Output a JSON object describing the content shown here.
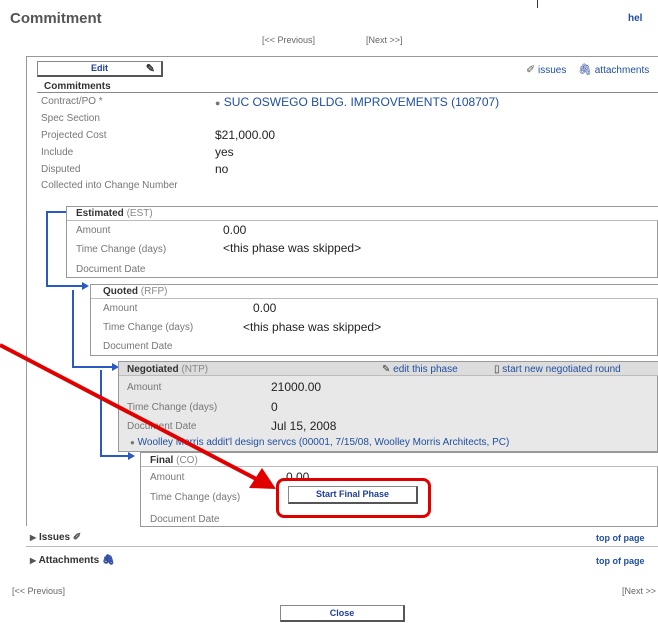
{
  "window": {
    "title": "Commitment",
    "help": "hel"
  },
  "nav": {
    "prev": "[<< Previous]",
    "next": "[Next >>]",
    "next_bottom": "[Next >>"
  },
  "toolbar": {
    "edit_label": "Edit",
    "issues_label": "issues",
    "attachments_label": "attachments"
  },
  "commitments": {
    "heading": "Commitments",
    "rows": [
      {
        "label": "Contract/PO *",
        "value": "SUC OSWEGO BLDG. IMPROVEMENTS (108707)"
      },
      {
        "label": "Spec Section",
        "value": ""
      },
      {
        "label": "Projected Cost",
        "value": "$21,000.00"
      },
      {
        "label": "Include",
        "value": "yes"
      },
      {
        "label": "Disputed",
        "value": "no"
      },
      {
        "label": "Collected into Change Number",
        "value": ""
      }
    ]
  },
  "phases": {
    "estimated": {
      "name": "Estimated",
      "code": "(EST)",
      "amount_label": "Amount",
      "amount": "0.00",
      "time_label": "Time Change (days)",
      "time": "<this phase was skipped>",
      "date_label": "Document Date"
    },
    "quoted": {
      "name": "Quoted",
      "code": "(RFP)",
      "amount_label": "Amount",
      "amount": "0.00",
      "time_label": "Time Change (days)",
      "time": "<this phase was skipped>",
      "date_label": "Document Date"
    },
    "negotiated": {
      "name": "Negotiated",
      "code": "(NTP)",
      "edit_label": "edit this phase",
      "new_round_label": "start new negotiated round",
      "amount_label": "Amount",
      "amount": "21000.00",
      "time_label": "Time Change (days)",
      "time": "0",
      "date_label": "Document Date",
      "date": "Jul 15, 2008",
      "link": "Woolley Morris addit'l design servcs (00001, 7/15/08, Woolley Morris Architects, PC)"
    },
    "final": {
      "name": "Final",
      "code": "(CO)",
      "amount_label": "Amount",
      "amount": "0.00",
      "time_label": "Time Change (days)",
      "date_label": "Document Date",
      "start_button": "Start Final Phase"
    }
  },
  "sections": {
    "issues": "Issues",
    "attachments": "Attachments",
    "top_of_page": "top of page"
  },
  "footer": {
    "close": "Close"
  },
  "annotation": {
    "color": "#e00000"
  }
}
